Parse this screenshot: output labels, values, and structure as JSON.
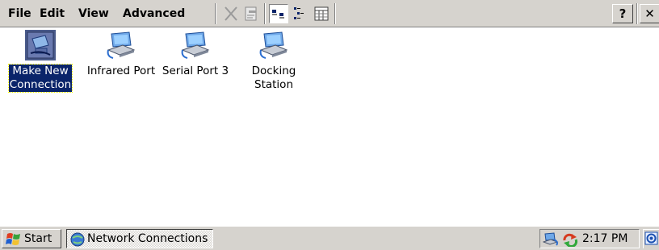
{
  "menu": {
    "file": "File",
    "edit": "Edit",
    "view": "View",
    "advanced": "Advanced"
  },
  "toolbar": {
    "buttons": [
      "delete-icon",
      "properties-icon",
      "large-icons-icon",
      "small-icons-icon",
      "details-icon"
    ],
    "help_label": "?",
    "close_label": "✕"
  },
  "items": [
    {
      "label_line1": "Make New",
      "label_line2": "Connection",
      "icon": "make-new-connection-icon",
      "selected": true
    },
    {
      "label_line1": "Infrared Port",
      "label_line2": "",
      "icon": "network-connection-icon",
      "selected": false
    },
    {
      "label_line1": "Serial Port 3",
      "label_line2": "",
      "icon": "network-connection-icon",
      "selected": false
    },
    {
      "label_line1": "Docking",
      "label_line2": "Station",
      "icon": "network-connection-icon",
      "selected": false
    }
  ],
  "taskbar": {
    "start_label": "Start",
    "task_label": "Network Connections",
    "clock": "2:17 PM"
  },
  "colors": {
    "chrome": "#d6d3ce",
    "selection": "#0a246a"
  }
}
